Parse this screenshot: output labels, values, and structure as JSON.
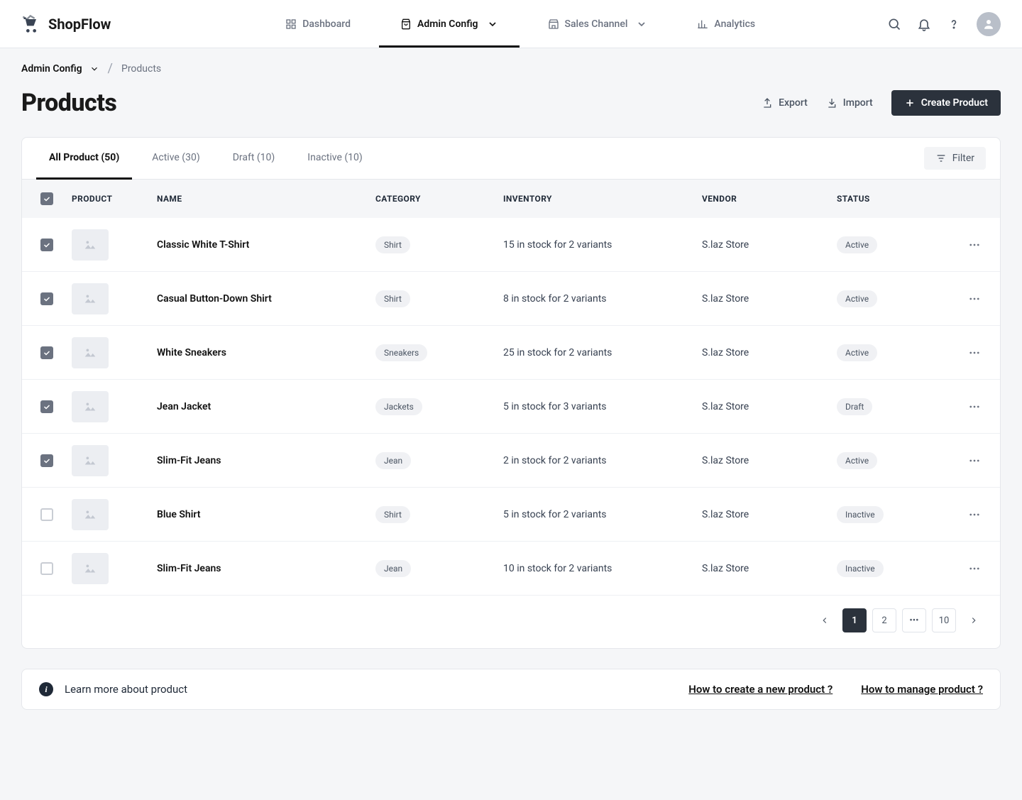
{
  "brand": "ShopFlow",
  "nav": {
    "dashboard": "Dashboard",
    "admin": "Admin Config",
    "sales": "Sales Channel",
    "analytics": "Analytics"
  },
  "breadcrumb": {
    "root": "Admin Config",
    "leaf": "Products"
  },
  "page": {
    "title": "Products",
    "export": "Export",
    "import": "Import",
    "create": "Create Product"
  },
  "tabs": {
    "all": "All Product (50)",
    "active": "Active (30)",
    "draft": "Draft (10)",
    "inactive": "Inactive (10)",
    "filter": "Filter"
  },
  "columns": {
    "product": "PRODUCT",
    "name": "NAME",
    "category": "CATEGORY",
    "inventory": "INVENTORY",
    "vendor": "VENDOR",
    "status": "STATUS"
  },
  "rows": [
    {
      "checked": true,
      "name": "Classic White T-Shirt",
      "category": "Shirt",
      "inventory": "15 in stock for 2 variants",
      "vendor": "S.laz Store",
      "status": "Active"
    },
    {
      "checked": true,
      "name": "Casual Button-Down Shirt",
      "category": "Shirt",
      "inventory": "8 in stock for 2 variants",
      "vendor": "S.laz Store",
      "status": "Active"
    },
    {
      "checked": true,
      "name": "White Sneakers",
      "category": "Sneakers",
      "inventory": "25 in stock for 2 variants",
      "vendor": "S.laz Store",
      "status": "Active"
    },
    {
      "checked": true,
      "name": "Jean Jacket",
      "category": "Jackets",
      "inventory": "5 in stock for 3 variants",
      "vendor": "S.laz Store",
      "status": "Draft"
    },
    {
      "checked": true,
      "name": "Slim-Fit Jeans",
      "category": "Jean",
      "inventory": "2 in stock for 2 variants",
      "vendor": "S.laz Store",
      "status": "Active"
    },
    {
      "checked": false,
      "name": "Blue Shirt",
      "category": "Shirt",
      "inventory": "5 in stock for 2 variants",
      "vendor": "S.laz Store",
      "status": "Inactive"
    },
    {
      "checked": false,
      "name": "Slim-Fit Jeans",
      "category": "Jean",
      "inventory": "10 in stock for 2 variants",
      "vendor": "S.laz Store",
      "status": "Inactive"
    }
  ],
  "pagination": {
    "pages": [
      "1",
      "2",
      "10"
    ],
    "ell": "•••"
  },
  "info": {
    "text": "Learn more about product",
    "link1": "How to create a new product ?",
    "link2": "How to manage product ?"
  }
}
